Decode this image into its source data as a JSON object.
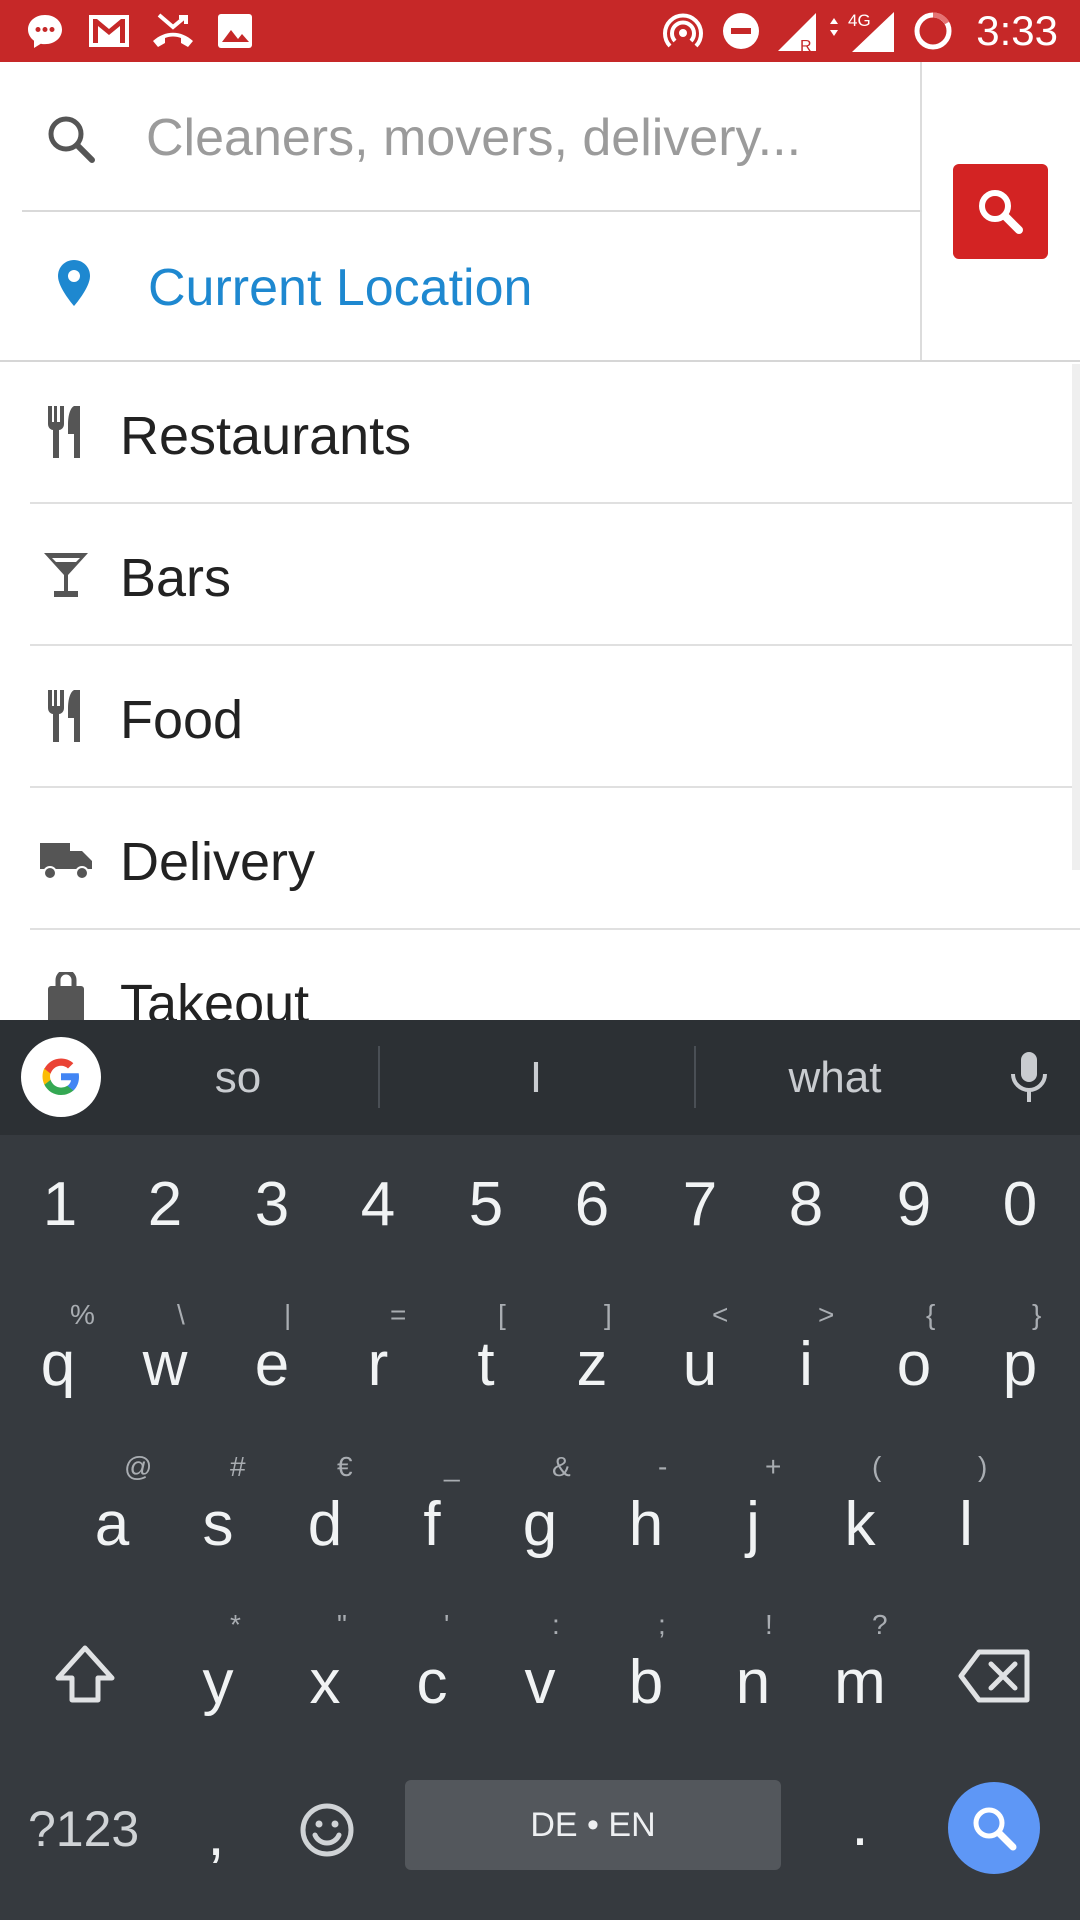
{
  "status_bar": {
    "time": "3:33",
    "network": "4G",
    "roaming": "R",
    "icons_left": [
      "chat-bubble-icon",
      "gmail-icon",
      "missed-call-icon",
      "image-icon"
    ],
    "icons_right": [
      "hotspot-icon",
      "do-not-disturb-icon",
      "signal-roaming-icon",
      "signal-4g-icon",
      "battery-icon"
    ]
  },
  "search": {
    "placeholder": "Cleaners, movers, delivery...",
    "value": "",
    "location_label": "Current Location",
    "accent_color": "#d32323"
  },
  "categories": [
    {
      "label": "Restaurants",
      "icon": "fork-knife-icon"
    },
    {
      "label": "Bars",
      "icon": "cocktail-icon"
    },
    {
      "label": "Food",
      "icon": "fork-knife-icon"
    },
    {
      "label": "Delivery",
      "icon": "truck-icon"
    },
    {
      "label": "Takeout",
      "icon": "bag-icon"
    }
  ],
  "keyboard": {
    "suggestions": [
      "so",
      "I",
      "what"
    ],
    "number_row": [
      "1",
      "2",
      "3",
      "4",
      "5",
      "6",
      "7",
      "8",
      "9",
      "0"
    ],
    "row1": [
      {
        "k": "q",
        "h": "%"
      },
      {
        "k": "w",
        "h": "\\"
      },
      {
        "k": "e",
        "h": "|"
      },
      {
        "k": "r",
        "h": "="
      },
      {
        "k": "t",
        "h": "["
      },
      {
        "k": "z",
        "h": "]"
      },
      {
        "k": "u",
        "h": "<"
      },
      {
        "k": "i",
        "h": ">"
      },
      {
        "k": "o",
        "h": "{"
      },
      {
        "k": "p",
        "h": "}"
      }
    ],
    "row2": [
      {
        "k": "a",
        "h": "@"
      },
      {
        "k": "s",
        "h": "#"
      },
      {
        "k": "d",
        "h": "€"
      },
      {
        "k": "f",
        "h": "_"
      },
      {
        "k": "g",
        "h": "&"
      },
      {
        "k": "h",
        "h": "-"
      },
      {
        "k": "j",
        "h": "+"
      },
      {
        "k": "k",
        "h": "("
      },
      {
        "k": "l",
        "h": ")"
      }
    ],
    "row3": [
      {
        "k": "y",
        "h": "*"
      },
      {
        "k": "x",
        "h": "\""
      },
      {
        "k": "c",
        "h": "'"
      },
      {
        "k": "v",
        "h": ":"
      },
      {
        "k": "b",
        "h": ";"
      },
      {
        "k": "n",
        "h": "!"
      },
      {
        "k": "m",
        "h": "?"
      }
    ],
    "symbols_label": "?123",
    "comma": ",",
    "period": ".",
    "space_label": "DE • EN"
  }
}
